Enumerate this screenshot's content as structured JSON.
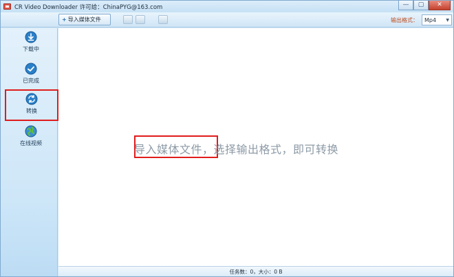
{
  "window": {
    "title": "CR Video Downloader  许可给：ChinaPYG@163.com",
    "controls": {
      "minimize": "—",
      "maximize": "▢",
      "close": "✕"
    }
  },
  "toolbar": {
    "import_label": "导入媒体文件",
    "output_label": "输出格式：",
    "format_value": "Mp4"
  },
  "sidebar": {
    "items": [
      {
        "label": "下载中",
        "icon": "download-icon"
      },
      {
        "label": "已完成",
        "icon": "checkmark-icon"
      },
      {
        "label": "转换",
        "icon": "convert-icon",
        "active": true
      },
      {
        "label": "在线视频",
        "icon": "globe-icon"
      }
    ]
  },
  "main": {
    "hint": "导入媒体文件，选择输出格式，即可转换"
  },
  "status": {
    "text": "任务数：0，大小：0 B"
  },
  "colors": {
    "accent": "#2a6fb5",
    "highlight": "#e01b1b",
    "output_label": "#c04b1c"
  }
}
